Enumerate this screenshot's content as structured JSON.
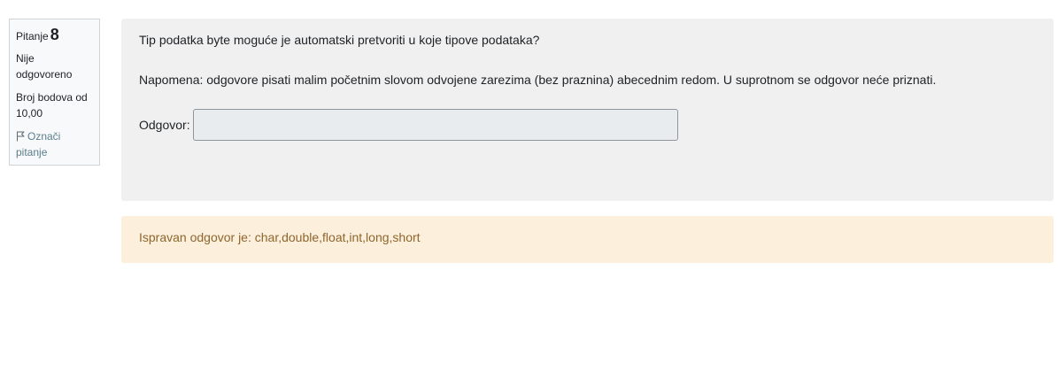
{
  "info": {
    "question_label": "Pitanje",
    "question_number": "8",
    "state": "Nije odgovoreno",
    "grade": "Broj bodova od 10,00",
    "flag_label": "Označi pitanje",
    "flag_icon": "flag-icon"
  },
  "question": {
    "text": "Tip podatka byte moguće je automatski pretvoriti u koje tipove podataka?",
    "note": "Napomena: odgovore pisati malim početnim slovom odvojene zarezima (bez praznina) abecednim redom. U suprotnom se odgovor neće priznati.",
    "answer_label": "Odgovor:",
    "answer_value": ""
  },
  "feedback": {
    "right_answer": "Ispravan odgovor je: char,double,float,int,long,short"
  },
  "colors": {
    "info_bg": "#f8f9fa",
    "formulation_bg": "#f0f0f0",
    "outcome_bg": "#fcefdc",
    "outcome_text": "#8e662e",
    "flag_text": "#5a7d8c"
  }
}
